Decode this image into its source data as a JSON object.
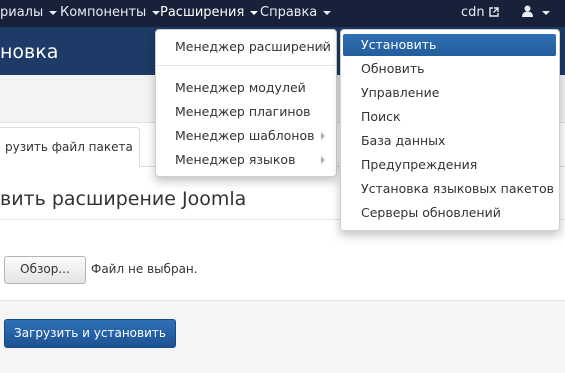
{
  "navbar": {
    "items": [
      {
        "label": "риалы"
      },
      {
        "label": "Компоненты"
      },
      {
        "label": "Расширения"
      },
      {
        "label": "Справка"
      }
    ],
    "site_link": "cdn"
  },
  "page": {
    "title": "новка",
    "tabs": [
      {
        "label": "рузить файл пакета"
      }
    ],
    "section_title": "вить расширение Joomla",
    "browse_button": "Обзор...",
    "file_status": "Файл не выбран.",
    "upload_button": "Загрузить и установить"
  },
  "extensions_menu": {
    "top_item": "Менеджер расширений",
    "items": [
      "Менеджер модулей",
      "Менеджер плагинов",
      "Менеджер шаблонов",
      "Менеджер языков"
    ]
  },
  "submenu": {
    "items": [
      "Установить",
      "Обновить",
      "Управление",
      "Поиск",
      "База данных",
      "Предупреждения",
      "Установка языковых пакетов",
      "Серверы обновлений"
    ],
    "highlighted": "Установить"
  },
  "colors": {
    "navbar": "#17213a",
    "header": "#1d3b66",
    "accent": "#2f6fb3"
  },
  "icons": [
    "caret-down-icon",
    "external-link-icon",
    "user-icon",
    "chevron-right-icon"
  ]
}
